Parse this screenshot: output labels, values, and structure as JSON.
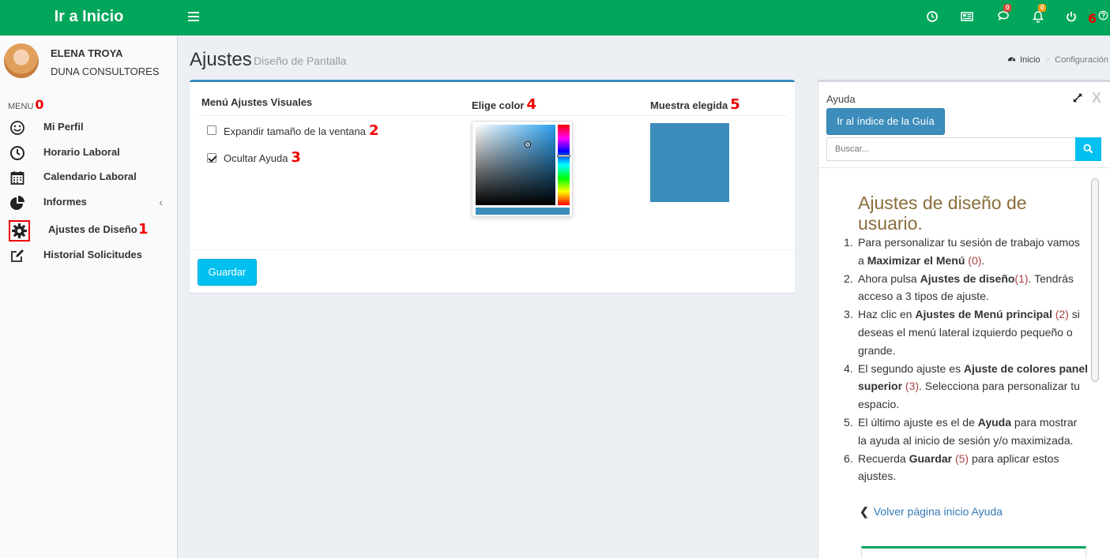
{
  "header": {
    "logo": "Ir a Inicio",
    "messages_badge": "0",
    "notifications_badge": "0",
    "help_marker": "6"
  },
  "user": {
    "name": "ELENA TROYA",
    "company": "DUNA CONSULTORES"
  },
  "sidebar": {
    "menu_label": "MENU",
    "menu_marker": "0",
    "items": [
      {
        "label": "Mi Perfil",
        "icon": "smile-icon"
      },
      {
        "label": "Horario Laboral",
        "icon": "clock-icon"
      },
      {
        "label": "Calendario Laboral",
        "icon": "calendar-icon"
      },
      {
        "label": "Informes",
        "icon": "pie-chart-icon"
      },
      {
        "label": "Ajustes de Diseño",
        "icon": "gear-icon",
        "marker": "1"
      },
      {
        "label": "Historial Solicitudes",
        "icon": "edit-icon"
      }
    ]
  },
  "page": {
    "title": "Ajustes",
    "subtitle": "Diseño de Pantalla",
    "breadcrumb": [
      "Inicio",
      "Configuración"
    ]
  },
  "settings": {
    "col1_header": "Menú Ajustes Visuales",
    "col2_header": "Elige color",
    "col2_marker": "4",
    "col3_header": "Muestra elegida",
    "col3_marker": "5",
    "option1_label": "Expandir tamaño de la ventana",
    "option1_checked": false,
    "option1_marker": "2",
    "option2_label": "Ocultar Ayuda",
    "option2_checked": true,
    "option2_marker": "3",
    "chosen_color": "#3c8dbc",
    "save_label": "Guardar"
  },
  "help": {
    "title": "Ayuda",
    "close_label": "X",
    "guide_button": "Ir al índice de la Guía",
    "search_placeholder": "Buscar...",
    "heading": "Ajustes de diseño de usuario.",
    "steps": [
      {
        "n": "1.",
        "pre": "Para personalizar tu sesión de trabajo vamos a ",
        "bold": "Maximizar el Menú",
        "ref": " (0)",
        "post": "."
      },
      {
        "n": "2.",
        "pre": "Ahora pulsa ",
        "bold": "Ajustes de diseño",
        "ref": "(1)",
        "post": ". Tendrás acceso a 3 tipos de ajuste."
      },
      {
        "n": "3.",
        "pre": "Haz clic en ",
        "bold": "Ajustes de Menú principal",
        "ref": " (2)",
        "post": " si deseas el menú lateral izquierdo pequeño o grande."
      },
      {
        "n": "4.",
        "pre": "El segundo ajuste es ",
        "bold": "Ajuste de colores panel superior",
        "ref": " (3)",
        "post": ". Selecciona para personalizar tu espacio."
      },
      {
        "n": "5.",
        "pre": "El último ajuste es el de ",
        "bold": "Ayuda",
        "ref": "",
        "post": " para mostrar la ayuda al inicio de sesión y/o maximizada."
      },
      {
        "n": "6.",
        "pre": "Recuerda ",
        "bold": "Guardar",
        "ref": " (5)",
        "post": " para aplicar estos ajustes."
      }
    ],
    "back_link": "Volver página inicio Ayuda"
  },
  "colors": {
    "header_green": "#00a65a",
    "accent_blue": "#3c8dbc",
    "info_cyan": "#00c0ef",
    "marker_red": "#ee0000"
  }
}
